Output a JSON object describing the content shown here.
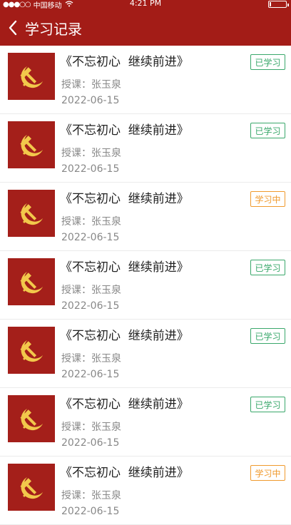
{
  "status_bar": {
    "signal": "●●●○○",
    "carrier": "中国移动",
    "time": "4:21 PM",
    "battery_level": 0.08
  },
  "header": {
    "title": "学习记录",
    "background": "#a31c17"
  },
  "records": [
    {
      "title": "《不忘初心  继续前进》",
      "teacher": "授课：张玉泉",
      "date": "2022-06-15",
      "status": "已学习",
      "status_type": "done"
    },
    {
      "title": "《不忘初心  继续前进》",
      "teacher": "授课：张玉泉",
      "date": "2022-06-15",
      "status": "已学习",
      "status_type": "done"
    },
    {
      "title": "《不忘初心  继续前进》",
      "teacher": "授课：张玉泉",
      "date": "2022-06-15",
      "status": "学习中",
      "status_type": "progress"
    },
    {
      "title": "《不忘初心  继续前进》",
      "teacher": "授课：张玉泉",
      "date": "2022-06-15",
      "status": "已学习",
      "status_type": "done"
    },
    {
      "title": "《不忘初心  继续前进》",
      "teacher": "授课：张玉泉",
      "date": "2022-06-15",
      "status": "已学习",
      "status_type": "done"
    },
    {
      "title": "《不忘初心  继续前进》",
      "teacher": "授课：张玉泉",
      "date": "2022-06-15",
      "status": "已学习",
      "status_type": "done"
    },
    {
      "title": "《不忘初心  继续前进》",
      "teacher": "授课：张玉泉",
      "date": "2022-06-15",
      "status": "学习中",
      "status_type": "progress"
    }
  ],
  "thumbnail_icon": "hammer-sickle-icon",
  "colors": {
    "done": "#3aa86b",
    "progress": "#f09a2e",
    "thumb_bg": "#a41f1a",
    "emblem": "#f2c84b"
  }
}
